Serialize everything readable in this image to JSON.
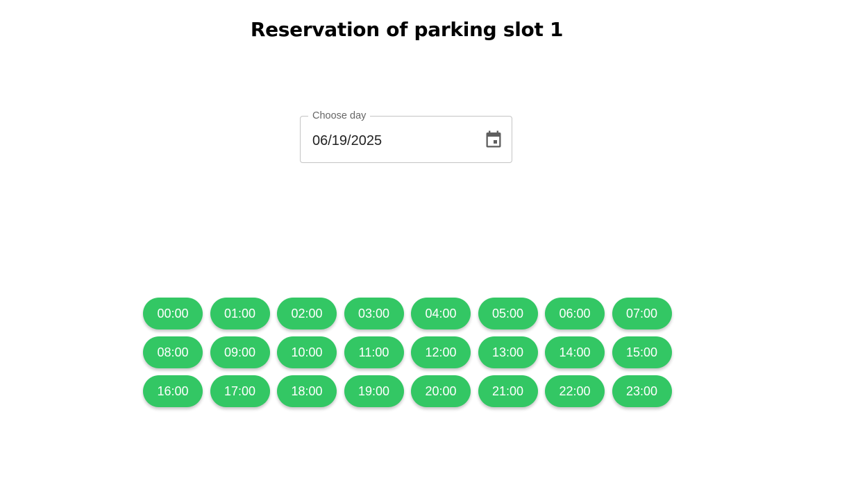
{
  "header": {
    "title": "Reservation of parking slot 1"
  },
  "date_picker": {
    "label": "Choose day",
    "value": "06/19/2025",
    "icon": "calendar-icon"
  },
  "time_slots": [
    "00:00",
    "01:00",
    "02:00",
    "03:00",
    "04:00",
    "05:00",
    "06:00",
    "07:00",
    "08:00",
    "09:00",
    "10:00",
    "11:00",
    "12:00",
    "13:00",
    "14:00",
    "15:00",
    "16:00",
    "17:00",
    "18:00",
    "19:00",
    "20:00",
    "21:00",
    "22:00",
    "23:00"
  ],
  "colors": {
    "slot_background": "#33c764",
    "slot_text": "#ffffff",
    "field_border": "#c4c4c4",
    "label_text": "#666666",
    "icon": "#5f5f5f"
  }
}
